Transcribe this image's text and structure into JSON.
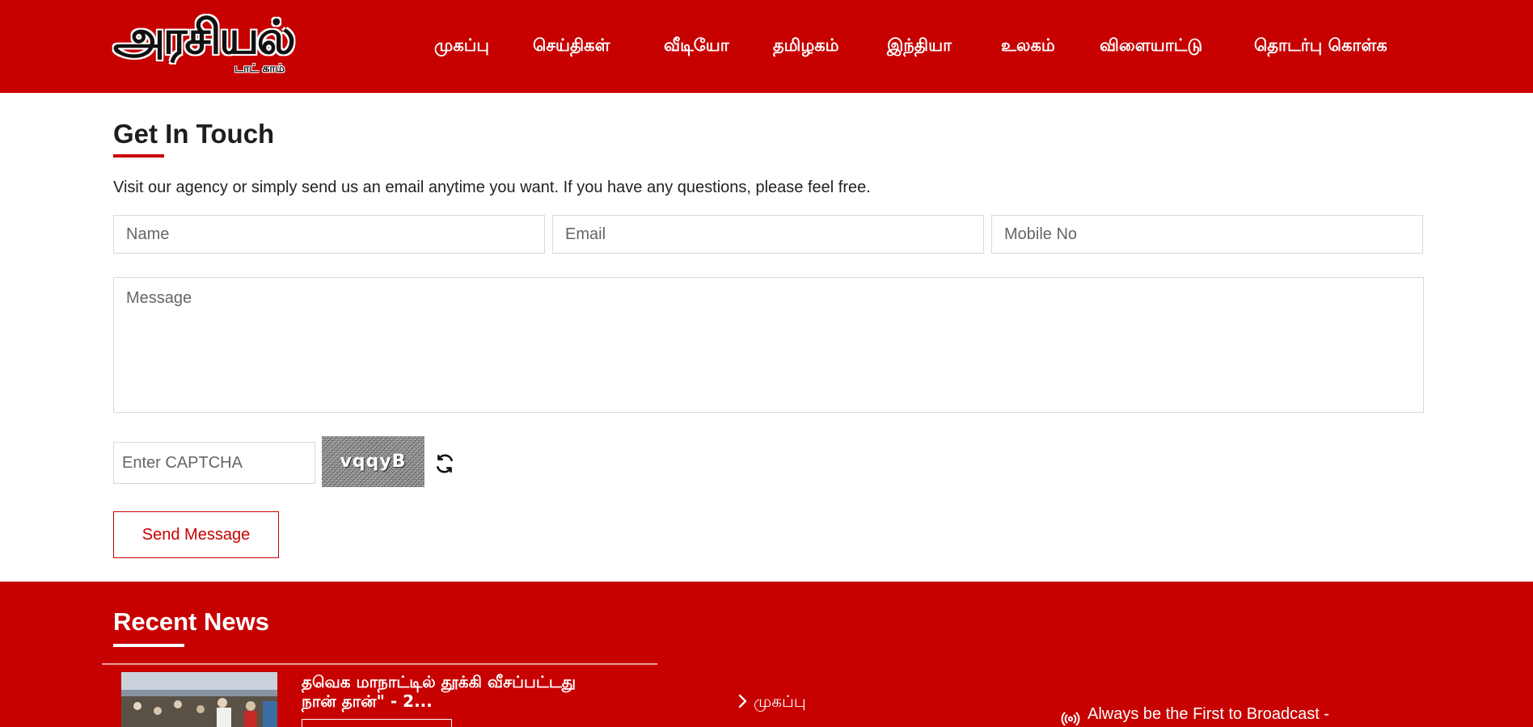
{
  "header": {
    "logo_main": "அரசியல்",
    "logo_sub": "டாட் காம்",
    "nav": [
      {
        "label": "முகப்பு"
      },
      {
        "label": "செய்திகள்"
      },
      {
        "label": "வீடியோ"
      },
      {
        "label": "தமிழகம்"
      },
      {
        "label": "இந்தியா"
      },
      {
        "label": "உலகம்"
      },
      {
        "label": "விளையாட்டு"
      },
      {
        "label": "தொடர்பு கொள்க"
      }
    ]
  },
  "contact": {
    "title": "Get In Touch",
    "intro": "Visit our agency or simply send us an email anytime you want. If you have any questions, please feel free.",
    "name_placeholder": "Name",
    "email_placeholder": "Email",
    "mobile_placeholder": "Mobile No",
    "message_placeholder": "Message",
    "captcha_placeholder": "Enter CAPTCHA",
    "captcha_code": "vqqyB",
    "send_label": "Send Message"
  },
  "footer": {
    "recent_title": "Recent News",
    "news_item_title": "தவெக மாநாட்டில் தூக்கி வீசப்பட்டது நான் தான்\" - 2...",
    "link_home": "முகப்பு",
    "broadcast_text": "Always be the First to Broadcast -"
  },
  "colors": {
    "brand_red": "#c70000",
    "text_dark": "#1e1e1e",
    "border": "#d8d8d8"
  },
  "icons": {
    "refresh": "refresh-icon",
    "chevron": "chevron-right-icon",
    "broadcast": "broadcast-icon"
  }
}
